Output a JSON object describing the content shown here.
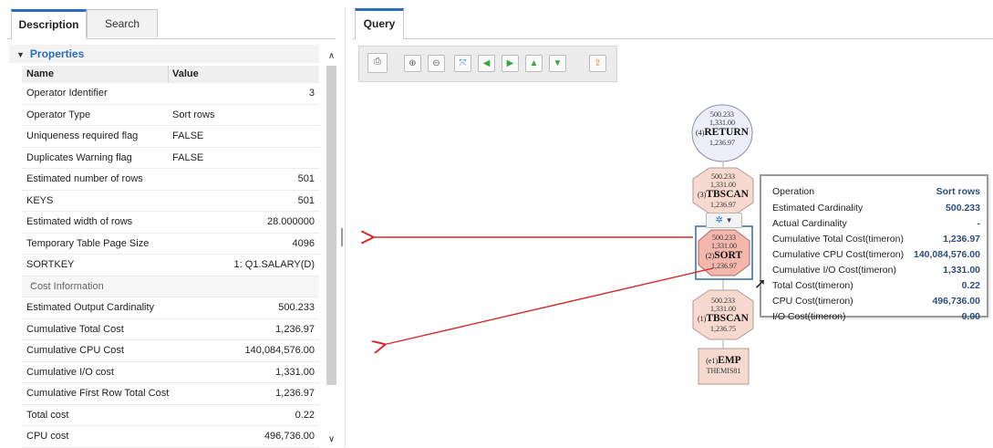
{
  "left_tabs": [
    "Description",
    "Search"
  ],
  "properties": {
    "title": "Properties",
    "columns": [
      "Name",
      "Value"
    ],
    "rows": [
      {
        "name": "Operator Identifier",
        "value": "3",
        "align": "right"
      },
      {
        "name": "Operator Type",
        "value": "Sort rows",
        "align": "left"
      },
      {
        "name": "Uniqueness required flag",
        "value": "FALSE",
        "align": "left"
      },
      {
        "name": "Duplicates Warning flag",
        "value": "FALSE",
        "align": "left"
      },
      {
        "name": "Estimated number of rows",
        "value": "501",
        "align": "right"
      },
      {
        "name": "KEYS",
        "value": "501",
        "align": "right"
      },
      {
        "name": "Estimated width of rows",
        "value": "28.000000",
        "align": "right"
      },
      {
        "name": "Temporary Table Page Size",
        "value": "4096",
        "align": "right"
      },
      {
        "name": "SORTKEY",
        "value": "1: Q1.SALARY(D)",
        "align": "right"
      }
    ],
    "cost_section": "Cost Information",
    "cost_rows": [
      {
        "name": "Estimated Output Cardinality",
        "value": "500.233"
      },
      {
        "name": "Cumulative Total Cost",
        "value": "1,236.97"
      },
      {
        "name": "Cumulative CPU Cost",
        "value": "140,084,576.00"
      },
      {
        "name": "Cumulative I/O cost",
        "value": "1,331.00"
      },
      {
        "name": "Cumulative First Row Total Cost",
        "value": "1,236.97"
      },
      {
        "name": "Total cost",
        "value": "0.22"
      },
      {
        "name": "CPU cost",
        "value": "496,736.00"
      }
    ]
  },
  "query_tab": "Query",
  "toolbar": [
    "export-icon",
    "zoom-in-icon",
    "zoom-out-icon",
    "fit-icon",
    "arrow-left-icon",
    "arrow-right-icon",
    "arrow-up-icon",
    "arrow-down-icon",
    "share-icon"
  ],
  "nodes": {
    "return": {
      "rows": "500.233",
      "io": "1,331.00",
      "id": "(4)",
      "op": "RETURN",
      "cost": "1,236.97"
    },
    "tbscan3": {
      "rows": "500.233",
      "io": "1,331.00",
      "id": "(3)",
      "op": "TBSCAN",
      "cost": "1,236.97"
    },
    "sort": {
      "rows": "500.233",
      "io": "1,331.00",
      "id": "(2)",
      "op": "SORT",
      "cost": "1,236.97"
    },
    "tbscan1": {
      "rows": "500.233",
      "io": "1,331.00",
      "id": "(1)",
      "op": "TBSCAN",
      "cost": "1,236.75"
    },
    "emp": {
      "id": "(e1)",
      "op": "EMP",
      "schema": "THEMIS81"
    }
  },
  "tooltip": {
    "header_label": "Operation",
    "header_value": "Sort rows",
    "rows": [
      {
        "label": "Estimated Cardinality",
        "value": "500.233"
      },
      {
        "label": "Actual Cardinality",
        "value": "-"
      },
      {
        "label": "Cumulative Total Cost(timeron)",
        "value": "1,236.97"
      },
      {
        "label": "Cumulative CPU Cost(timeron)",
        "value": "140,084,576.00"
      },
      {
        "label": "Cumulative I/O Cost(timeron)",
        "value": "1,331.00"
      },
      {
        "label": "Total Cost(timeron)",
        "value": "0.22"
      },
      {
        "label": "CPU Cost(timeron)",
        "value": "496,736.00"
      },
      {
        "label": "I/O Cost(timeron)",
        "value": "0.00"
      }
    ]
  },
  "colors": {
    "accent": "#2a6ebb",
    "annotation_arrow": "#d42a2a",
    "node_fill": "#f7d9cf",
    "return_fill": "#eceffa"
  }
}
